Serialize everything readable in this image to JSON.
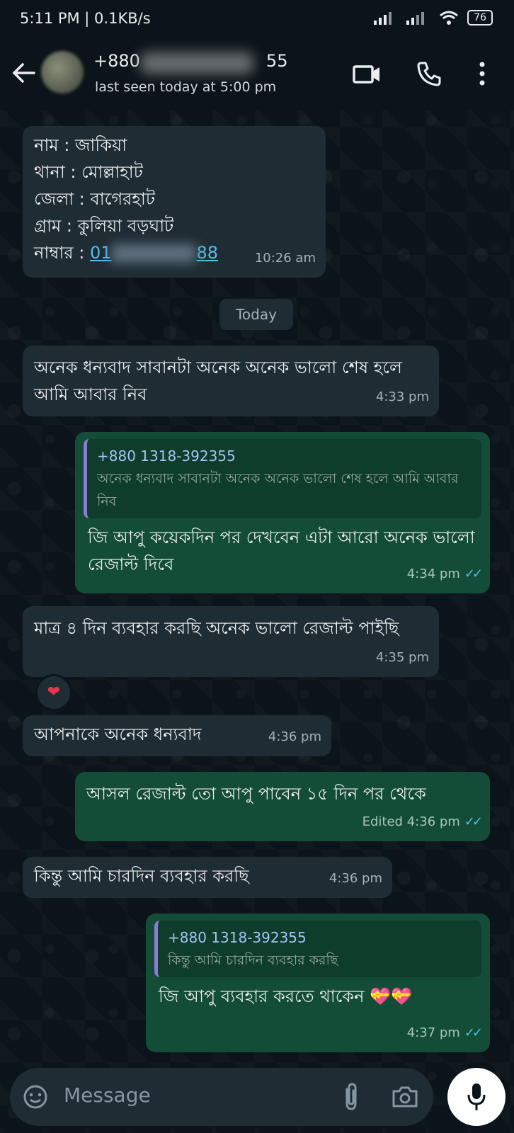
{
  "status_bar": {
    "time": "5:11 PM | 0.1KB/s",
    "battery": "76"
  },
  "header": {
    "contact_name": "+880",
    "contact_name_suffix": "55",
    "last_seen": "last seen today at 5:00 pm"
  },
  "messages": {
    "m1": {
      "lines": [
        "নাম : জাকিয়া",
        "থানা : মোল্লাহাট",
        "জেলা : বাগেরহাট",
        "গ্রাম : কুলিয়া বড়ঘাট"
      ],
      "phone_label": "নাম্বার : ",
      "phone_start": "01",
      "phone_end": "88",
      "time": "10:26 am"
    },
    "date_chip": "Today",
    "m2": {
      "text": "অনেক ধন্যবাদ সাবানটা অনেক অনেক ভালো শেষ হলে আমি আবার নিব",
      "time": "4:33 pm"
    },
    "m3": {
      "quote_name": "+880 1318-392355",
      "quote_text": "অনেক ধন্যবাদ সাবানটা অনেক অনেক ভালো শেষ হলে আমি আবার নিব",
      "text": "জি আপু কয়েকদিন পর দেখবেন এটা আরো অনেক ভালো রেজাল্ট দিবে",
      "time": "4:34 pm"
    },
    "m4": {
      "text": "মাত্র ৪ দিন ব্যবহার করছি অনেক ভালো রেজাল্ট পাইছি",
      "time": "4:35 pm",
      "reaction": "❤"
    },
    "m5": {
      "text": "আপনাকে অনেক ধন্যবাদ",
      "time": "4:36 pm"
    },
    "m6": {
      "text": "আসল রেজাল্ট তো আপু পাবেন ১৫ দিন পর থেকে",
      "edited": "Edited",
      "time": "4:36 pm"
    },
    "m7": {
      "text": "কিন্তু আমি চারদিন ব্যবহার করছি",
      "time": "4:36 pm"
    },
    "m8": {
      "quote_name": "+880 1318-392355",
      "quote_text": "কিন্তু আমি চারদিন ব্যবহার করছি",
      "text": "জি আপু ব্যবহার করতে থাকেন 💝💝",
      "time": "4:37 pm"
    }
  },
  "composer": {
    "placeholder": "Message"
  },
  "colors": {
    "incoming": "#1f2c34",
    "outgoing": "#144d37",
    "read_ticks": "#53bdeb",
    "background": "#0b141a"
  }
}
